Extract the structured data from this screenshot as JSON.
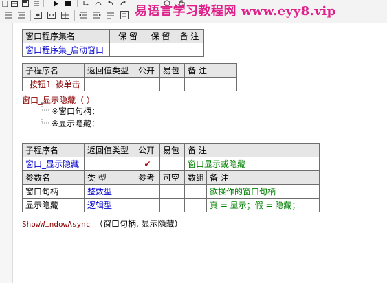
{
  "watermark": "易语言学习教程网 www.eyy8.vip",
  "toolbar": {
    "row1": [
      "D",
      "|",
      "□",
      "≡",
      "▶",
      "■",
      "↶",
      "↷",
      "☞"
    ],
    "row2_icons": [
      "format-icon",
      "indent-icon",
      "outdent-icon",
      "comment-icon",
      "uncomment-icon",
      "param-icon"
    ]
  },
  "assembly_table": {
    "headers": [
      "窗口程序集名",
      "保  留",
      "保  留",
      "备  注"
    ],
    "row": [
      "窗口程序集_启动窗口",
      "",
      "",
      ""
    ]
  },
  "sub1_table": {
    "headers": [
      "子程序名",
      "返回值类型",
      "公开",
      "易包",
      "备  注"
    ],
    "row": [
      "_按钮1_被单击",
      "",
      "",
      "",
      ""
    ]
  },
  "call": {
    "text": "窗口_显示隐藏（ ）",
    "params": [
      "※窗口句柄：",
      "※显示隐藏："
    ]
  },
  "sub2_table": {
    "headers": [
      "子程序名",
      "返回值类型",
      "公开",
      "易包",
      "备  注"
    ],
    "row": [
      "窗口_显示隐藏",
      "",
      "✔",
      "",
      "窗口显示或隐藏"
    ],
    "param_headers": [
      "参数名",
      "类  型",
      "参考",
      "可空",
      "数组",
      "备  注"
    ],
    "params": [
      [
        "窗口句柄",
        "整数型",
        "",
        "",
        "",
        "欲操作的窗口句柄"
      ],
      [
        "显示隐藏",
        "逻辑型",
        "",
        "",
        "",
        "真 = 显示；假 = 隐藏；"
      ]
    ]
  },
  "api_call": {
    "name": "ShowWindowAsync",
    "args": "（窗口句柄, 显示隐藏）"
  }
}
